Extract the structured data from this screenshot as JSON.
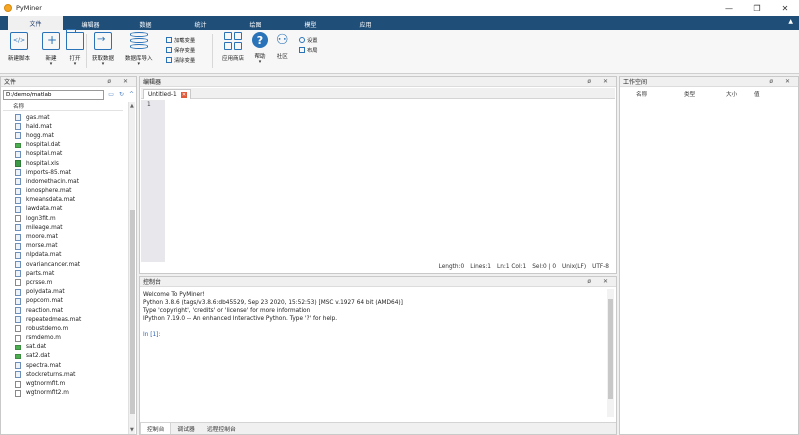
{
  "app": {
    "title": "PyMiner"
  },
  "window_controls": {
    "minimize": "—",
    "maximize": "❐",
    "close": "✕"
  },
  "ribbon": {
    "tabs": [
      "文件",
      "编辑器",
      "数据",
      "统计",
      "绘图",
      "模型",
      "应用"
    ],
    "collapse": "▲",
    "buttons": {
      "new_script": "新建脚本",
      "new": "新建",
      "open": "打开",
      "fetch_data": "获取数据",
      "database_import": "数据库导入",
      "load_var": "加载变量",
      "save_var": "保存变量",
      "clear_var": "清除变量",
      "app_store": "应用商店",
      "help": "帮助",
      "community": "社区",
      "settings": "设置",
      "layout": "布局"
    }
  },
  "file_panel": {
    "title": "文件",
    "controls": "ø ✕",
    "path": "D:/demo/matlab",
    "path_buttons": [
      "▭",
      "↻",
      "^"
    ],
    "column_name": "名称",
    "files": [
      {
        "name": "gas.mat",
        "kind": "mat"
      },
      {
        "name": "hald.mat",
        "kind": "mat"
      },
      {
        "name": "hogg.mat",
        "kind": "mat"
      },
      {
        "name": "hospital.dat",
        "kind": "dat"
      },
      {
        "name": "hospital.mat",
        "kind": "mat"
      },
      {
        "name": "hospital.xls",
        "kind": "xls"
      },
      {
        "name": "imports-85.mat",
        "kind": "mat"
      },
      {
        "name": "indomethacin.mat",
        "kind": "mat"
      },
      {
        "name": "ionosphere.mat",
        "kind": "mat"
      },
      {
        "name": "kmeansdata.mat",
        "kind": "mat"
      },
      {
        "name": "lawdata.mat",
        "kind": "mat"
      },
      {
        "name": "logn3fit.m",
        "kind": "m"
      },
      {
        "name": "mileage.mat",
        "kind": "mat"
      },
      {
        "name": "moore.mat",
        "kind": "mat"
      },
      {
        "name": "morse.mat",
        "kind": "mat"
      },
      {
        "name": "nlpdata.mat",
        "kind": "mat"
      },
      {
        "name": "ovariancancer.mat",
        "kind": "mat"
      },
      {
        "name": "parts.mat",
        "kind": "mat"
      },
      {
        "name": "pcrsse.m",
        "kind": "m"
      },
      {
        "name": "polydata.mat",
        "kind": "mat"
      },
      {
        "name": "popcorn.mat",
        "kind": "mat"
      },
      {
        "name": "reaction.mat",
        "kind": "mat"
      },
      {
        "name": "repeatedmeas.mat",
        "kind": "mat"
      },
      {
        "name": "robustdemo.m",
        "kind": "m"
      },
      {
        "name": "rsmdemo.m",
        "kind": "m"
      },
      {
        "name": "sat.dat",
        "kind": "dat"
      },
      {
        "name": "sat2.dat",
        "kind": "dat"
      },
      {
        "name": "spectra.mat",
        "kind": "mat"
      },
      {
        "name": "stockreturns.mat",
        "kind": "mat"
      },
      {
        "name": "wgtnormfit.m",
        "kind": "m"
      },
      {
        "name": "wgtnormfit2.m",
        "kind": "m"
      }
    ]
  },
  "editor": {
    "title": "编辑器",
    "controls": "ø ✕",
    "tab_label": "Untitled-1",
    "tab_close": "✕",
    "line_number": "1",
    "status": {
      "length": "Length:0",
      "lines": "Lines:1",
      "ln_col": "Ln:1 Col:1",
      "sel": "Sel:0 | 0",
      "eol": "Unix(LF)",
      "encoding": "UTF-8"
    }
  },
  "console": {
    "title": "控制台",
    "controls": "ø ✕",
    "lines": [
      "Welcome To PyMiner!",
      "Python 3.8.6 (tags/v3.8.6:db45529, Sep 23 2020, 15:52:53) [MSC v.1927 64 bit (AMD64)]",
      "Type 'copyright', 'credits' or 'license' for more information",
      "IPython 7.19.0 -- An enhanced Interactive Python. Type '?' for help."
    ],
    "prompt": "In [1]:",
    "tabs": [
      "控制台",
      "调试器",
      "远程控制台"
    ]
  },
  "workspace": {
    "title": "工作空间",
    "controls": "ø ✕",
    "columns": [
      "名称",
      "类型",
      "大小",
      "值"
    ]
  },
  "colors": {
    "ribbon_bar": "#1f4e79",
    "accent": "#2a73b8"
  }
}
